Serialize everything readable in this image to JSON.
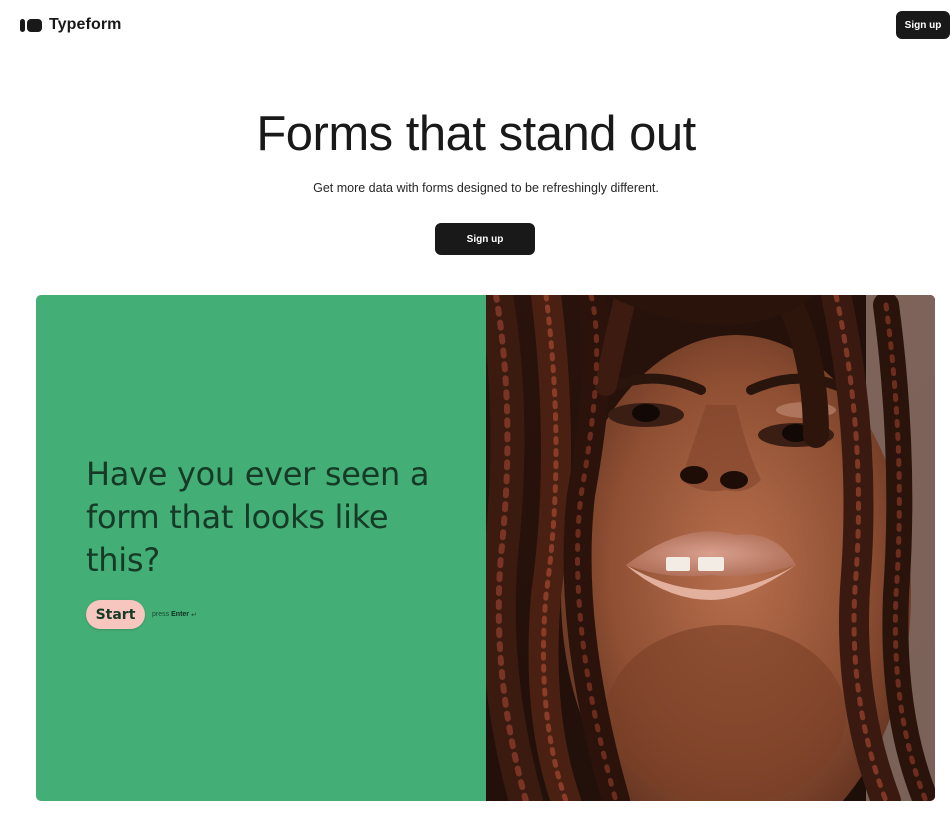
{
  "header": {
    "brand": "Typeform",
    "signup_label": "Sign up"
  },
  "hero": {
    "title": "Forms that stand out",
    "subtitle": "Get more data with forms designed to be refreshingly different.",
    "signup_label": "Sign up"
  },
  "demo": {
    "question": "Have you ever seen a form that looks like this?",
    "start_label": "Start",
    "hint_prefix": "press",
    "hint_key": "Enter",
    "hint_glyph": "↵",
    "photo_icon": "portrait-photo"
  },
  "colors": {
    "dark": "#191919",
    "form_green": "#43ae76",
    "start_pink": "#f6c6bf",
    "question_text": "#163a26"
  }
}
